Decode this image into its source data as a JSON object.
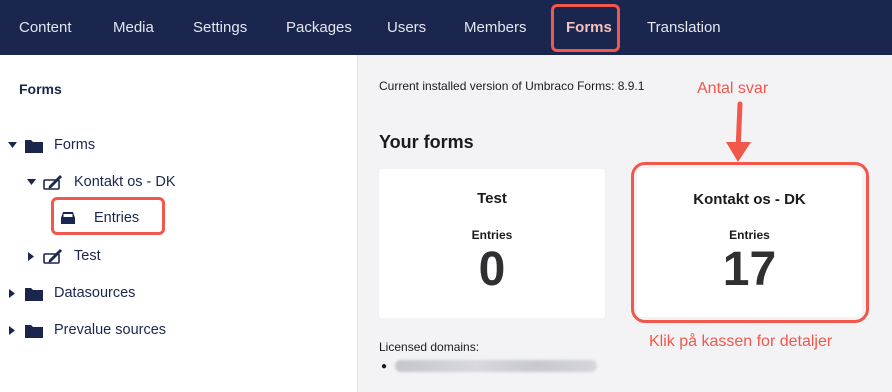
{
  "topnav": {
    "items": [
      {
        "label": "Content"
      },
      {
        "label": "Media"
      },
      {
        "label": "Settings"
      },
      {
        "label": "Packages"
      },
      {
        "label": "Users"
      },
      {
        "label": "Members"
      },
      {
        "label": "Forms"
      },
      {
        "label": "Translation"
      }
    ],
    "active": "Forms"
  },
  "sidebar": {
    "title": "Forms",
    "tree": {
      "forms_root": "Forms",
      "kontakt_form": "Kontakt os - DK",
      "entries": "Entries",
      "test_form": "Test",
      "datasources": "Datasources",
      "prevalue_sources": "Prevalue sources"
    }
  },
  "main": {
    "version_text": "Current installed version of Umbraco Forms: 8.9.1",
    "section_title": "Your forms",
    "cards": [
      {
        "title": "Test",
        "entries_label": "Entries",
        "count": "0"
      },
      {
        "title": "Kontakt os - DK",
        "entries_label": "Entries",
        "count": "17"
      }
    ],
    "licensed_label": "Licensed domains:"
  },
  "annotations": {
    "antal_svar": "Antal svar",
    "klik_detaljer": "Klik på kassen for detaljer"
  },
  "colors": {
    "topbar": "#1b264f",
    "accent": "#f2574c",
    "active_nav": "#f5c1bc"
  }
}
